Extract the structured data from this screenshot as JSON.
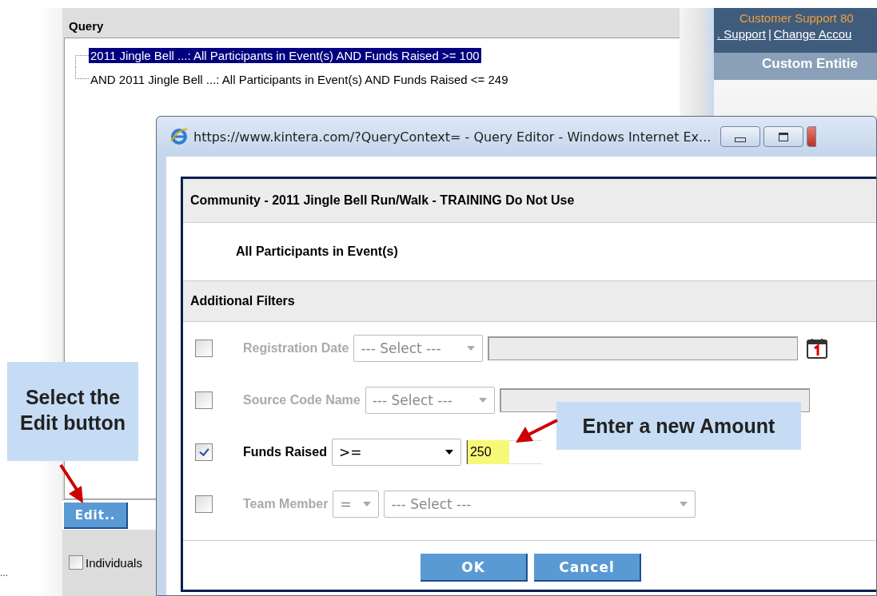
{
  "edge_text": "...",
  "query_panel": {
    "title": "Query",
    "tree": [
      {
        "label": "2011 Jingle Bell ...: All Participants in Event(s) AND Funds Raised >= 100",
        "selected": true
      },
      {
        "label": "AND 2011 Jingle Bell ...: All Participants in Event(s) AND Funds Raised <= 249",
        "selected": false
      }
    ],
    "edit_button": "Edit..",
    "options": [
      {
        "label": "Individuals",
        "checked": false
      }
    ]
  },
  "side_panel": {
    "title": "Customer Support 80",
    "links": [
      ". Support",
      "Change Accou"
    ],
    "separator": "|",
    "section": "Custom Entitie"
  },
  "dialog": {
    "title": "https://www.kintera.com/?QueryContext= - Query Editor - Windows Internet Ex...",
    "heading": "Community - 2011 Jingle Bell Run/Walk - TRAINING Do Not Use",
    "subheading": "All Participants in Event(s)",
    "filters_title": "Additional Filters",
    "filters": [
      {
        "kind": "date",
        "label": "Registration Date",
        "checked": false,
        "disabled": true,
        "operator": "--- Select ---"
      },
      {
        "kind": "text",
        "label": "Source Code Name",
        "checked": false,
        "disabled": true,
        "operator": "--- Select ---"
      },
      {
        "kind": "number",
        "label": "Funds Raised",
        "checked": true,
        "disabled": false,
        "operator": ">=",
        "value": "250"
      },
      {
        "kind": "choice",
        "label": "Team Member",
        "checked": false,
        "disabled": true,
        "operator": "=",
        "choice": "--- Select ---"
      }
    ],
    "buttons": [
      "OK",
      "Cancel"
    ]
  },
  "callouts": [
    {
      "kind": "down",
      "text": "Select the Edit button"
    },
    {
      "kind": "left",
      "text": "Enter a new Amount"
    }
  ]
}
